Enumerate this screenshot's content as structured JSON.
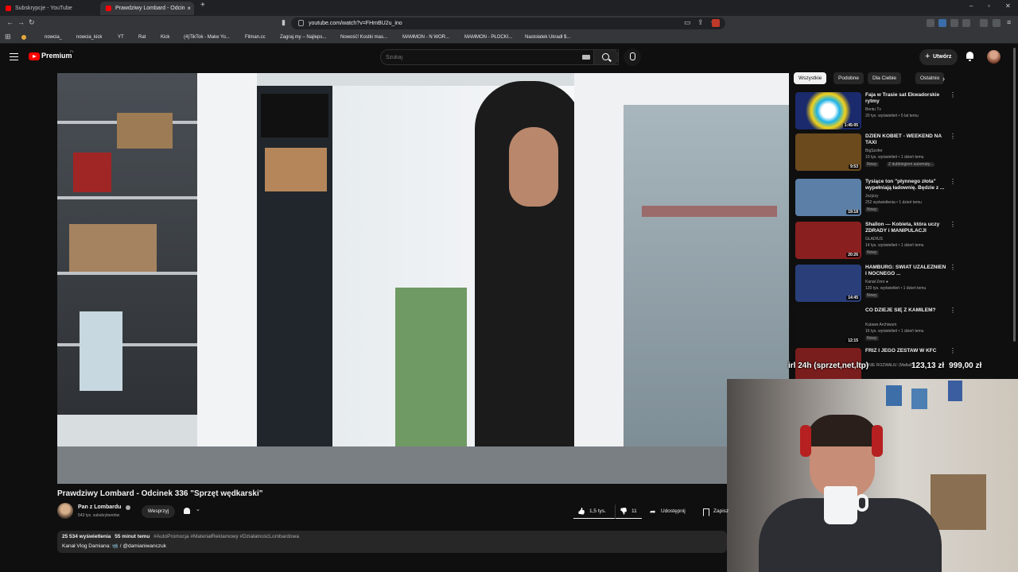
{
  "browser": {
    "tabs": [
      {
        "title": "Subskrypcje - YouTube",
        "active": false
      },
      {
        "title": "Prawdziwy Lombard - Odcin",
        "active": true
      }
    ],
    "new_tab": "+",
    "close": "×",
    "url": "youtube.com/watch?v=FHmBU2u_ino",
    "window_controls": [
      "–",
      "▫",
      "✕"
    ],
    "bookmarks": [
      "nowcia_",
      "nowcia_kick",
      "YT",
      "Rat",
      "Kick",
      "(4)TikTok - Make Yo...",
      "Filman.cc",
      "Zagraj.my – Najleps...",
      "Nowość! Kostki mas...",
      "MAMMON - N WOR...",
      "MAMMON - PŁOCKI...",
      "Nastolatek Ukradł $..."
    ]
  },
  "youtube": {
    "logo_text": "Premium",
    "country_code": "PL",
    "search_placeholder": "Szukaj",
    "create_label": "Utwórz"
  },
  "video": {
    "title": "Prawdziwy Lombard - Odcinek 336 \"Sprzęt wędkarski\"",
    "channel": "Pan z Lombardu",
    "subscribers": "543 tys. subskrybentów",
    "support_label": "Wesprzyj",
    "likes": "1,5 tys.",
    "dislikes": "11",
    "share_label": "Udostępnij",
    "save_label": "Zapisz",
    "views": "25 534 wyświetlenia",
    "time_ago": "55 minut temu",
    "tags": "#AutoPromocja #MateriałReklamowy #DziałalnośćLombardowa",
    "desc_line2": "Kanał Vlog Damiana: 📹 / @damianiwanczuk"
  },
  "overlay": {
    "left_text": "irl 24h (sprzet,net,ltp)",
    "amount1": "123,13 zł",
    "amount2": "999,00 zł"
  },
  "sidebar": {
    "chips": [
      "Wszystkie",
      "Podobne",
      "Dla Ciebie",
      "Ostatnio"
    ],
    "chip_next": "›",
    "items": [
      {
        "title": "Faja w Trasie sat Ekwadorskie rytmy",
        "channel": "Bentu Tv",
        "meta": "20 tys. wyświetleń • 5 lat temu",
        "duration": "1:45:05",
        "badge": "",
        "badge2": "",
        "thumb_color": "#1a2a6c"
      },
      {
        "title": "DZIEŃ KOBIET - WEEKEND NA TAXI",
        "channel": "BigSzofer",
        "meta": "10 tys. wyświetleń • 1 dzień temu",
        "duration": "9:53",
        "badge": "Nowy",
        "badge2": "Z dubbingiem automaty...",
        "thumb_color": "#6b4a1e"
      },
      {
        "title": "Tysiące ton \"płynnego złota\" wypełniają ładownię. Będzie z ...",
        "channel": "Jozjzzy",
        "meta": "252 wyświetlenia • 1 dzień temu",
        "duration": "19:18",
        "badge": "Nowy",
        "badge2": "",
        "thumb_color": "#5b7fa6"
      },
      {
        "title": "Shallon — Kobieta, która uczy ZDRADY i MANIPULACJI",
        "channel": "GLADIUS",
        "meta": "14 tys. wyświetleń • 1 dzień temu",
        "duration": "20:26",
        "badge": "Nowy",
        "badge2": "",
        "thumb_color": "#8a1f1f"
      },
      {
        "title": "HAMBURG: ŚWIAT UZALEŻNIEŃ I NOCNEGO ...",
        "channel": "Kanał Zero ●",
        "meta": "120 tys. wyświetleń • 1 dzień temu",
        "duration": "14:45",
        "badge": "Nowy",
        "badge2": "",
        "thumb_color": "#2a3f7a"
      },
      {
        "title": "CO DZIEJE SIĘ Z KAMILEM?",
        "channel": "Kulawe Archiwum",
        "meta": "16 tys. wyświetleń • 1 dzień temu",
        "duration": "12:15",
        "badge": "Nowy",
        "badge2": "",
        "thumb_color": "#101010"
      },
      {
        "title": "FRIZ I JEGO ZESTAW W KFC",
        "channel": "MNIE ROZWALIŁ! (MafiaIRL)",
        "meta": "",
        "duration": "",
        "badge": "",
        "badge2": "",
        "thumb_color": "#7a1d1d"
      }
    ]
  },
  "colors": {
    "background": "#0f0f0f",
    "brand_red": "#ff0000",
    "chip_bg": "#272727"
  }
}
